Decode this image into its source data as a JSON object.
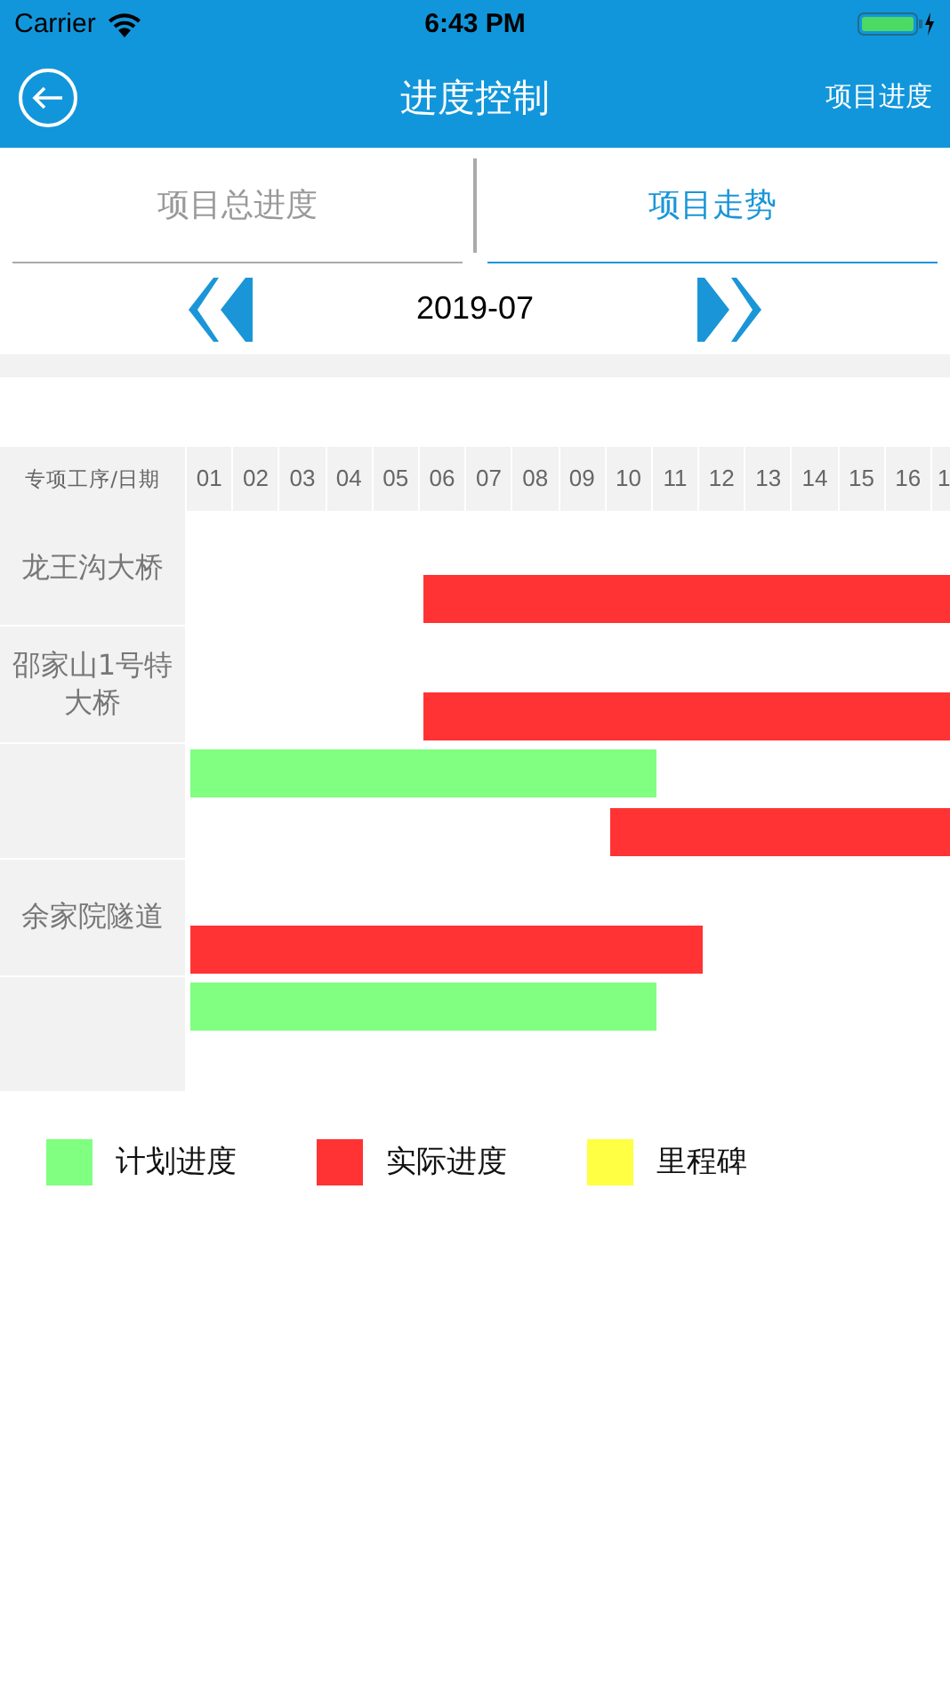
{
  "status_bar": {
    "carrier": "Carrier",
    "time": "6:43 PM"
  },
  "nav": {
    "title": "进度控制",
    "action": "项目进度"
  },
  "tabs": [
    {
      "label": "项目总进度",
      "selected": false
    },
    {
      "label": "项目走势",
      "selected": true
    }
  ],
  "month": "2019-07",
  "gantt": {
    "corner": "专项工序/日期",
    "days": [
      "01",
      "02",
      "03",
      "04",
      "05",
      "06",
      "07",
      "08",
      "09",
      "10",
      "11",
      "12",
      "13",
      "14",
      "15",
      "16",
      "1"
    ],
    "rows": [
      {
        "name": "龙王沟大桥",
        "lanes": [
          {
            "kind": "actual",
            "filled": [
              false,
              false,
              false,
              false,
              false,
              true,
              true,
              true,
              true,
              true,
              true,
              true,
              true,
              true,
              true,
              true,
              true
            ]
          }
        ]
      },
      {
        "name": "邵家山1号特大桥",
        "lanes": [
          {
            "kind": "actual",
            "filled": [
              false,
              false,
              false,
              false,
              false,
              true,
              true,
              true,
              true,
              true,
              true,
              true,
              true,
              true,
              true,
              true,
              true
            ]
          }
        ]
      },
      {
        "lanes": [
          {
            "kind": "plan",
            "filled": [
              true,
              true,
              true,
              true,
              true,
              true,
              true,
              true,
              true,
              true,
              false,
              false,
              false,
              false,
              false,
              false,
              false
            ]
          },
          {
            "kind": "actual",
            "filled": [
              false,
              false,
              false,
              false,
              false,
              false,
              false,
              false,
              false,
              true,
              true,
              true,
              true,
              true,
              true,
              true,
              true
            ]
          }
        ]
      },
      {
        "name": "余家院隧道",
        "lanes": [
          {
            "kind": "actual",
            "filled": [
              true,
              true,
              true,
              true,
              true,
              true,
              true,
              true,
              true,
              true,
              true,
              false,
              false,
              false,
              false,
              false,
              false
            ]
          }
        ]
      },
      {
        "lanes": [
          {
            "kind": "plan",
            "filled": [
              true,
              true,
              true,
              true,
              true,
              true,
              true,
              true,
              true,
              true,
              false,
              false,
              false,
              false,
              false,
              false,
              false
            ]
          }
        ]
      }
    ]
  },
  "legend": [
    {
      "label": "计划进度",
      "color": "#80ff80"
    },
    {
      "label": "实际进度",
      "color": "#ff3333"
    },
    {
      "label": "里程碑",
      "color": "#ffff44"
    }
  ]
}
